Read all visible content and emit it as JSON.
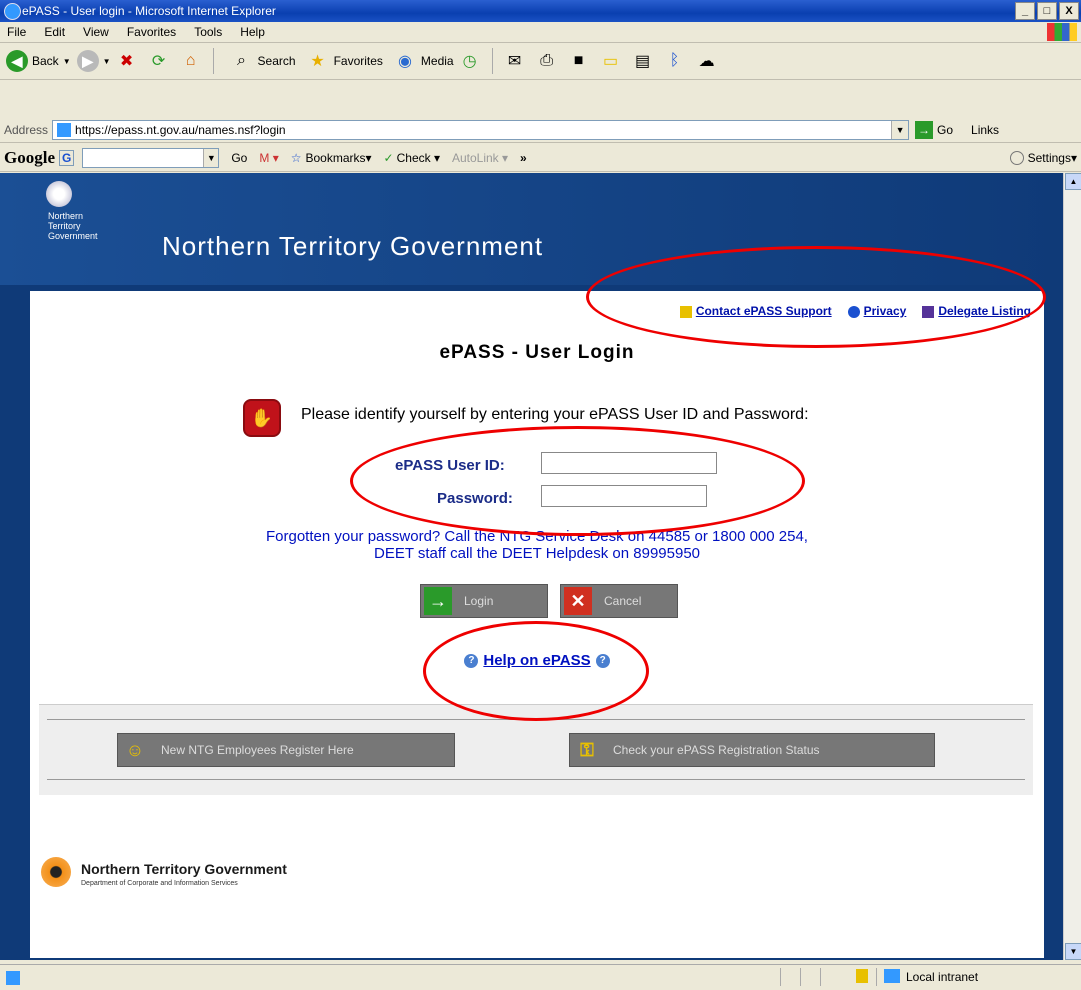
{
  "window": {
    "title": "ePASS - User login - Microsoft Internet Explorer",
    "buttons": [
      "_",
      "□",
      "X"
    ]
  },
  "menu": [
    "File",
    "Edit",
    "View",
    "Favorites",
    "Tools",
    "Help"
  ],
  "toolbar": {
    "back": "Back",
    "search": "Search",
    "favorites": "Favorites",
    "media": "Media"
  },
  "address": {
    "label": "Address",
    "url": "https://epass.nt.gov.au/names.nsf?login",
    "go": "Go",
    "links": "Links"
  },
  "google_bar": {
    "logo": "Google",
    "g_label": "G",
    "go": "Go",
    "bookmarks": "Bookmarks",
    "check": "Check",
    "autolink": "AutoLink",
    "more": "»",
    "settings": "Settings"
  },
  "banner": {
    "org_small_1": "Northern",
    "org_small_2": "Territory",
    "org_small_3": "Government",
    "title": "Northern Territory Government"
  },
  "links": {
    "contact": "Contact ePASS Support",
    "privacy": "Privacy",
    "delegate": "Delegate Listing"
  },
  "page": {
    "title": "ePASS - User Login",
    "instruction": "Please identify yourself by entering your ePASS User ID and Password:",
    "userid_label": "ePASS User ID:",
    "password_label": "Password:",
    "forgot_line1": "Forgotten your password? Call the NTG Service Desk on 44585 or 1800 000 254,",
    "forgot_line2": "DEET staff call the DEET Helpdesk on 89995950",
    "login_button": "Login",
    "cancel_button": "Cancel",
    "help_link": "Help on ePASS",
    "register_button": "New NTG Employees Register Here",
    "check_status_button": "Check your ePASS Registration Status"
  },
  "footer": {
    "org": "Northern Territory Government",
    "dept": "Department of Corporate and Information Services"
  },
  "status": {
    "zone": "Local intranet"
  },
  "colors": {
    "banner": "#0f3a78",
    "link": "#0010c0",
    "annotation": "#e00000"
  }
}
